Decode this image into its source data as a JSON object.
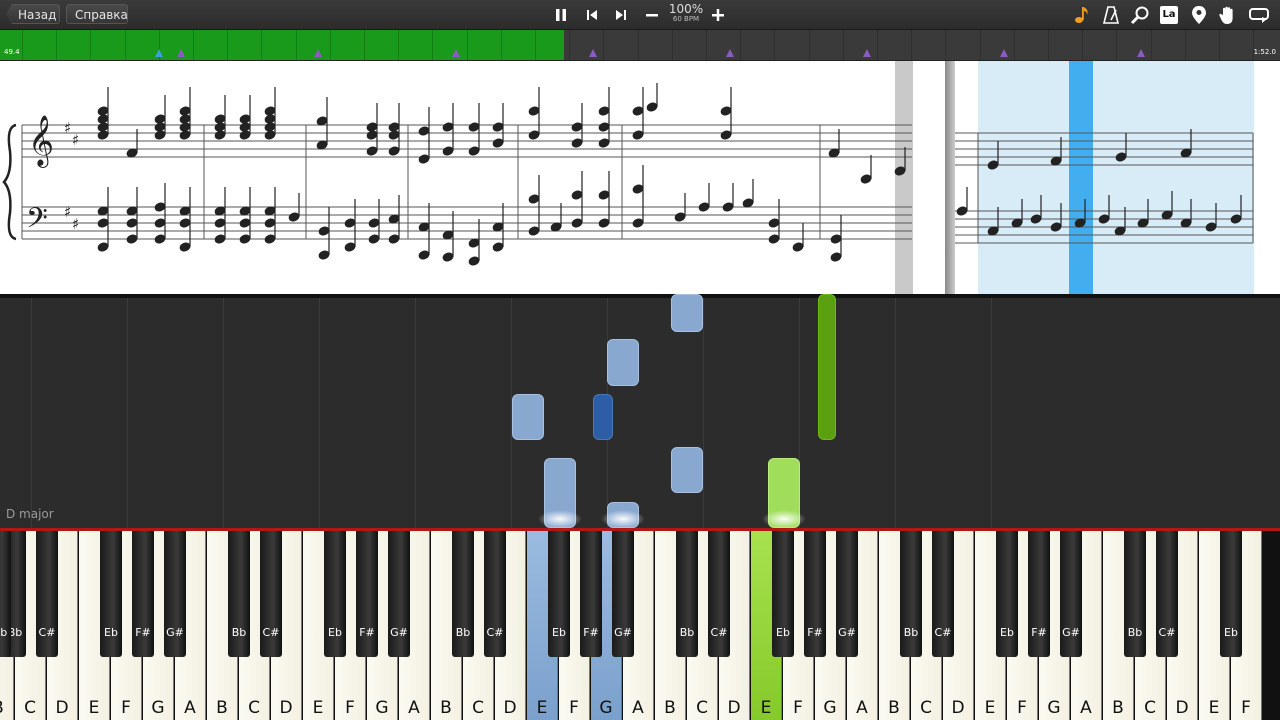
{
  "toolbar": {
    "back_label": "Назад",
    "help_label": "Справка",
    "tempo_percent": "100%",
    "tempo_bpm": "60 BPM",
    "right_icons": [
      "music-note-icon",
      "metronome-icon",
      "magnifier-icon",
      "note-label-icon",
      "location-pin-icon",
      "hand-icon",
      "loop-icon"
    ],
    "note_label_text": "La"
  },
  "timeline": {
    "current_time": "49.4",
    "total_time": "1:52.0",
    "progress_fraction": 0.441
  },
  "roll": {
    "key_signature": "D major"
  },
  "keyboard": {
    "white_keys": [
      "B",
      "C",
      "D",
      "E",
      "F",
      "G",
      "A",
      "B",
      "C",
      "D",
      "E",
      "F",
      "G",
      "A",
      "B",
      "C",
      "D",
      "E",
      "F",
      "G",
      "A",
      "B",
      "C",
      "D",
      "E",
      "F",
      "G",
      "A",
      "B",
      "C",
      "D",
      "E",
      "F",
      "G",
      "A",
      "B",
      "C",
      "D",
      "E",
      "F"
    ],
    "black_keys": [
      "Bb",
      "C#",
      "Eb",
      "F#",
      "G#",
      "Bb",
      "C#",
      "Eb",
      "F#",
      "G#",
      "Bb",
      "C#",
      "Eb",
      "F#",
      "G#",
      "Bb",
      "C#",
      "Eb",
      "F#",
      "G#",
      "Bb",
      "C#",
      "Eb",
      "F#",
      "G#",
      "Bb",
      "C#",
      "Eb",
      "F#",
      "G#",
      "Bb",
      "C#",
      "Eb",
      "F#"
    ],
    "lit_blue_whites": [
      17,
      19
    ],
    "lit_green_whites": [
      24
    ]
  },
  "colors": {
    "progress_green": "#1a9a1a",
    "left_hand_blue": "#88a8d0",
    "right_hand_green": "#9fdd5a",
    "marker_purple": "#8a5cc0",
    "cursor_blue": "#42aef0"
  }
}
